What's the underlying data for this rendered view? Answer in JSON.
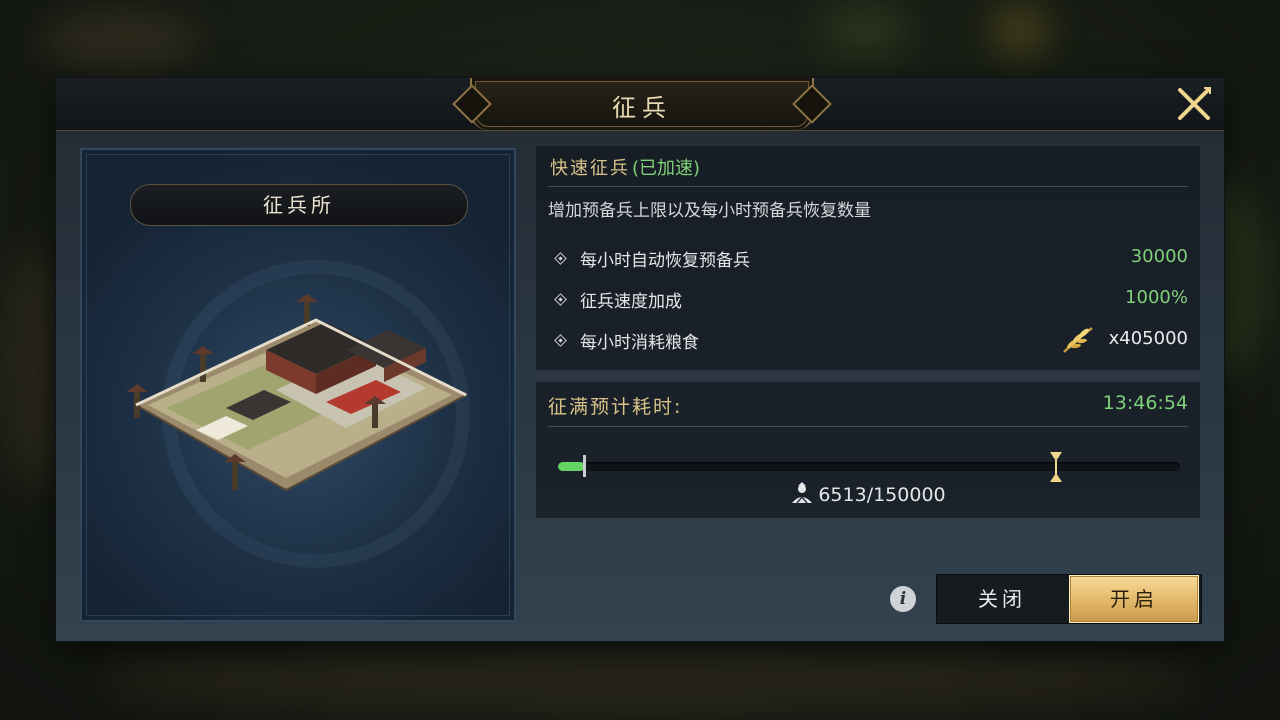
{
  "dialog": {
    "title": "征兵",
    "close_icon": "close-x-icon"
  },
  "building": {
    "name": "征兵所"
  },
  "quick_recruit": {
    "title": "快速征兵",
    "status": "(已加速)",
    "description": "增加预备兵上限以及每小时预备兵恢复数量",
    "stats": [
      {
        "label": "每小时自动恢复预备兵",
        "value": "30000"
      },
      {
        "label": "征兵速度加成",
        "value": "1000%"
      },
      {
        "label": "每小时消耗粮食",
        "value": "x405000",
        "icon": "grain-icon"
      }
    ]
  },
  "estimate": {
    "label": "征满预计耗时:",
    "value": "13:46:54",
    "troops": "6513/150000",
    "troop_current": 6513,
    "troop_max": 150000,
    "marker_fraction": 0.8
  },
  "buttons": {
    "close_label": "关闭",
    "open_label": "开启"
  },
  "colors": {
    "accent_gold": "#d8c288",
    "green": "#7fd07a",
    "button_gold": "#e2b768"
  }
}
